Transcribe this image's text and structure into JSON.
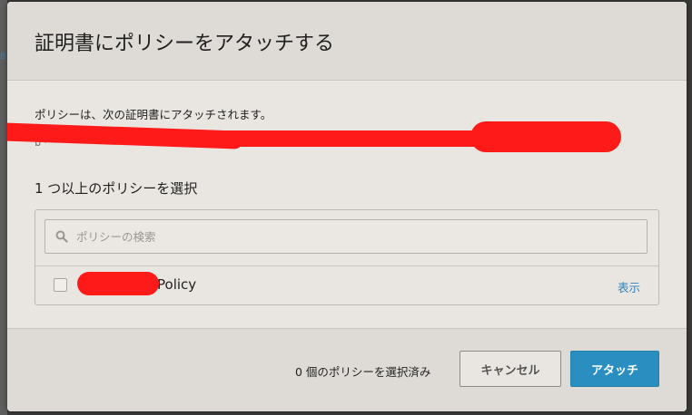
{
  "modal": {
    "title": "証明書にポリシーをアタッチする",
    "intro": "ポリシーは、次の証明書にアタッチされます。",
    "certificate_id": "b·····························································",
    "section_label": "1 つ以上のポリシーを選択"
  },
  "search": {
    "placeholder": "ポリシーの検索",
    "value": ""
  },
  "policies": [
    {
      "name_suffix": "Policy",
      "checked": false,
      "view_label": "表示"
    }
  ],
  "footer": {
    "selected_count": "0 個のポリシーを選択済み",
    "cancel_label": "キャンセル",
    "attach_label": "アタッチ"
  },
  "colors": {
    "accent": "#2a8fc0",
    "link": "#2e84b8",
    "redaction": "#ff1a1a"
  },
  "icons": {
    "search": "search-icon"
  }
}
